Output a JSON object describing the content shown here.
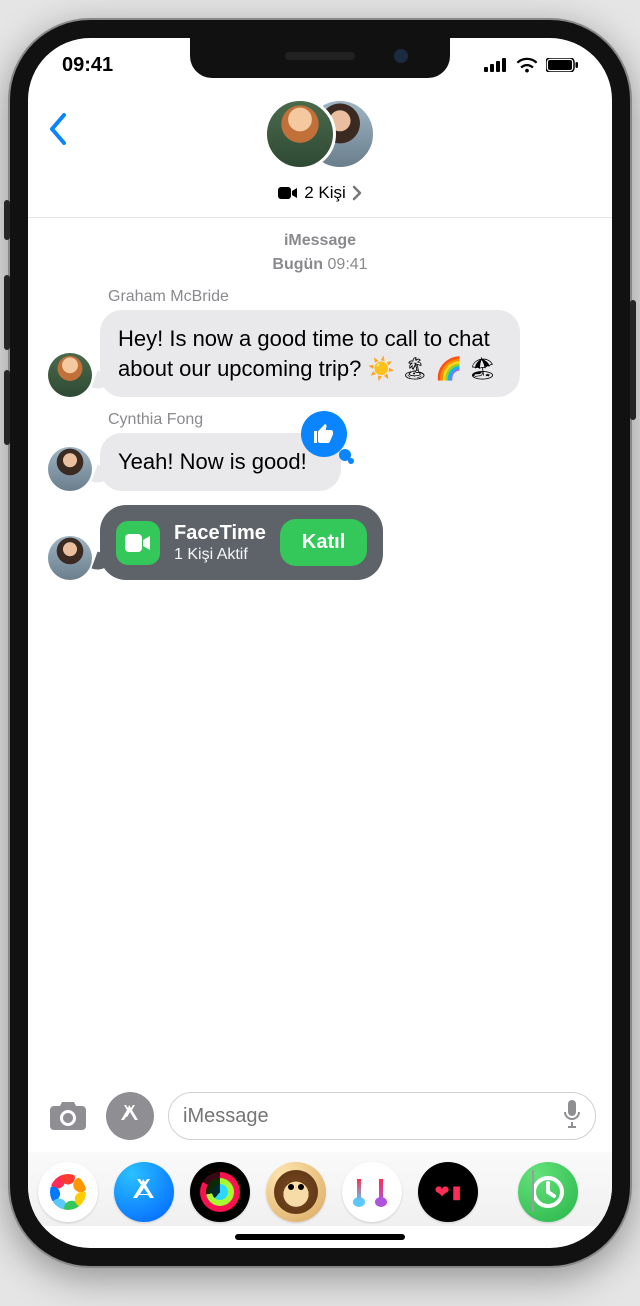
{
  "status": {
    "time": "09:41"
  },
  "header": {
    "group_label": "2 Kişi",
    "persons": [
      "Graham McBride",
      "Cynthia Fong"
    ]
  },
  "thread": {
    "service": "iMessage",
    "day_label": "Bugün",
    "time": "09:41"
  },
  "messages": [
    {
      "sender": "Graham McBride",
      "text": "Hey! Is now a good time to call to chat about our upcoming trip? ☀️ 🏝 🌈 🏖"
    },
    {
      "sender": "Cynthia Fong",
      "text": "Yeah! Now is good!",
      "tapback": "thumbs-up"
    }
  ],
  "facetime_card": {
    "title": "FaceTime",
    "subtitle": "1 Kişi Aktif",
    "join_label": "Katıl"
  },
  "input": {
    "placeholder": "iMessage"
  },
  "app_strip": {
    "items": [
      "photos",
      "app-store",
      "activity",
      "memoji",
      "music",
      "gif",
      "clock"
    ]
  }
}
